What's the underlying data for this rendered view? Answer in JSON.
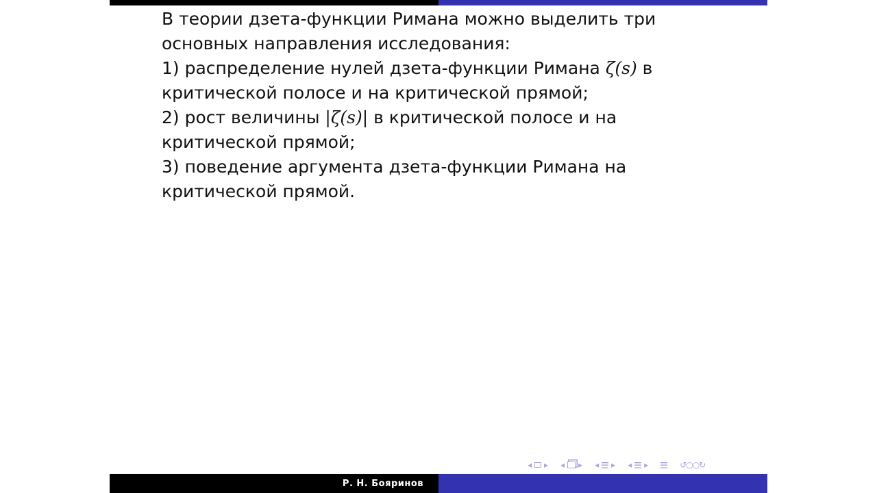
{
  "slide": {
    "paragraphs": [
      {
        "text_before": "В теории дзета-функции Римана можно выделить три основных направления исследования:",
        "math": "",
        "text_after": ""
      },
      {
        "text_before": "1) распределение нулей дзета-функции Римана ",
        "math": "ζ(s)",
        "text_after": " в критической полосе и на критической прямой;"
      },
      {
        "text_before": "2) рост величины ",
        "math": "|ζ(s)|",
        "text_after": " в критической полосе и на критической прямой;"
      },
      {
        "text_before": "3) поведение аргумента дзета-функции Римана на критической прямой.",
        "math": "",
        "text_after": ""
      }
    ]
  },
  "footer": {
    "author": "Р. Н. Бояринов"
  },
  "colors": {
    "frame_dark": "#000000",
    "frame_blue": "#3333b2",
    "nav_icon": "#a6a6d8"
  },
  "nav": {
    "icons": [
      "prev-frame-icon",
      "frame-icon",
      "next-frame-icon",
      "prev-subsection-icon",
      "subsection-icon",
      "next-subsection-icon",
      "prev-section-icon",
      "section-icon",
      "next-section-icon",
      "prev-section-end-icon",
      "appendix-icon",
      "search-icon"
    ]
  }
}
